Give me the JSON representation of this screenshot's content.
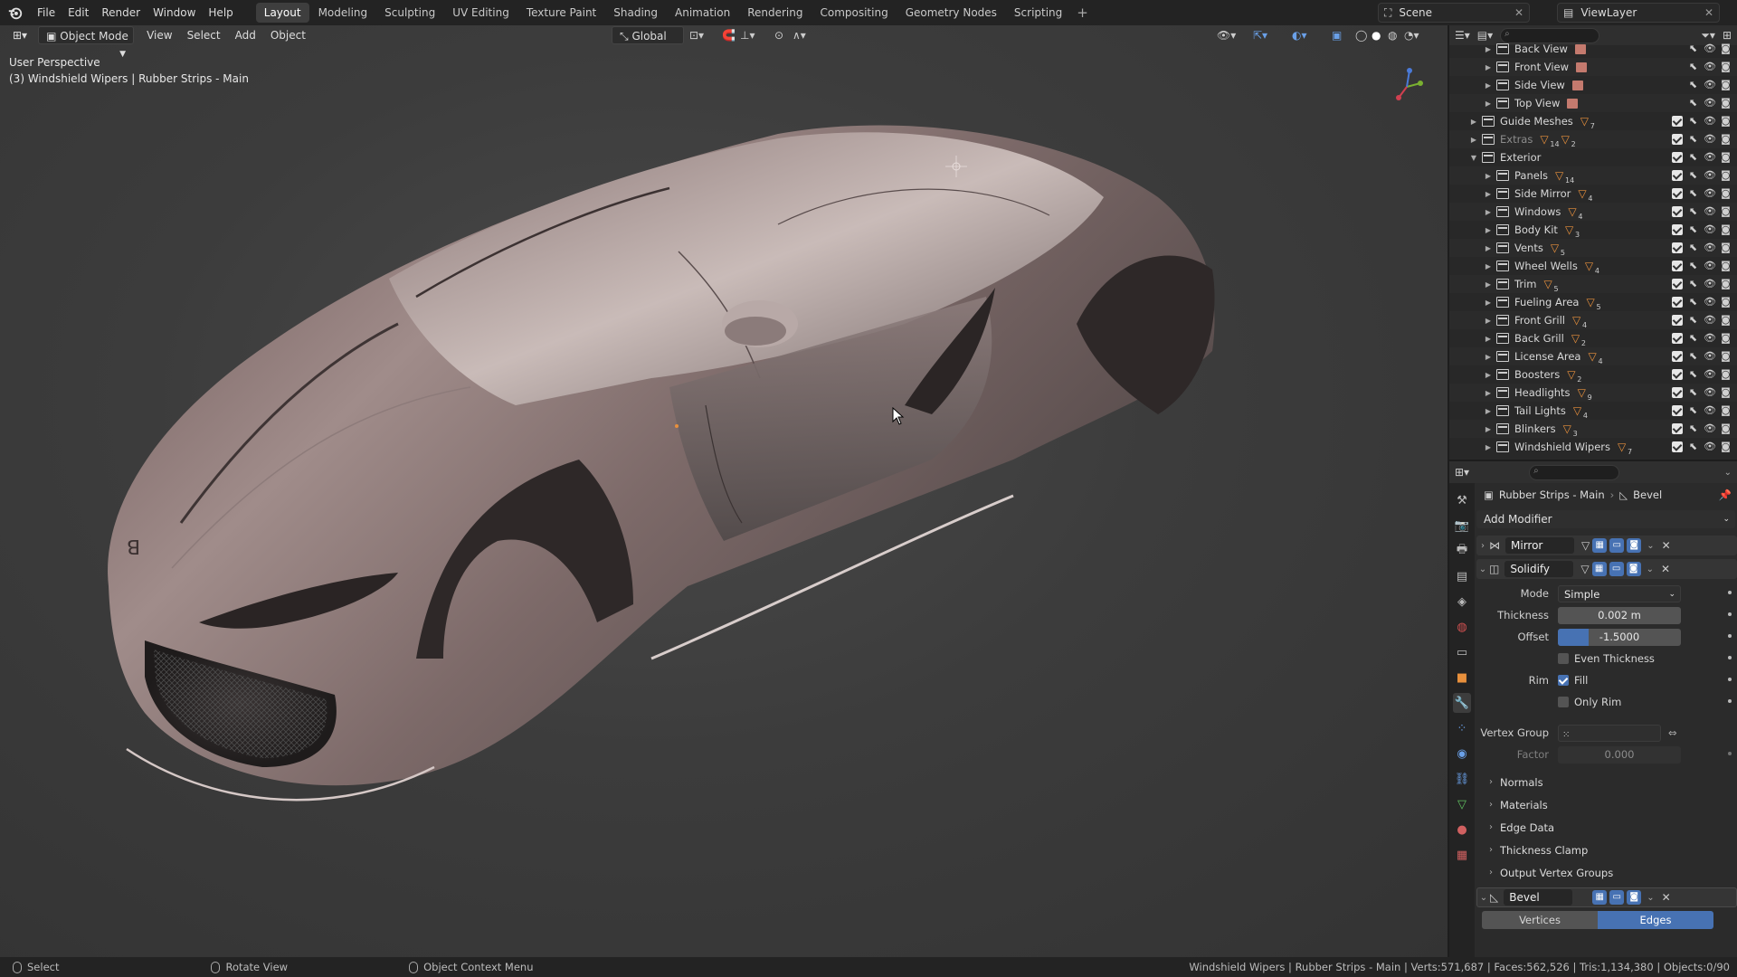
{
  "menu": {
    "items": [
      "File",
      "Edit",
      "Render",
      "Window",
      "Help"
    ],
    "workspaces": [
      "Layout",
      "Modeling",
      "Sculpting",
      "UV Editing",
      "Texture Paint",
      "Shading",
      "Animation",
      "Rendering",
      "Compositing",
      "Geometry Nodes",
      "Scripting"
    ],
    "active_workspace": "Layout",
    "add_tab": "+"
  },
  "scene": {
    "scene_name": "Scene",
    "view_layer": "ViewLayer"
  },
  "viewport": {
    "mode": "Object Mode",
    "menus": [
      "View",
      "Select",
      "Add",
      "Object"
    ],
    "orientation": "Global",
    "perspective_label": "User Perspective",
    "object_label": "(3) Windshield Wipers | Rubber Strips - Main"
  },
  "outliner": {
    "rows": [
      {
        "name": "Back View",
        "kind": "camera",
        "indent": 2
      },
      {
        "name": "Front View",
        "kind": "camera",
        "indent": 2
      },
      {
        "name": "Side View",
        "kind": "camera",
        "indent": 2
      },
      {
        "name": "Top View",
        "kind": "camera",
        "indent": 2
      },
      {
        "name": "Guide Meshes",
        "kind": "collection",
        "indent": 1,
        "count": "7"
      },
      {
        "name": "Extras",
        "kind": "collection",
        "indent": 1,
        "count": "14",
        "count2": "2",
        "dim": true
      },
      {
        "name": "Exterior",
        "kind": "collection",
        "indent": 1,
        "expanded": true
      },
      {
        "name": "Panels",
        "kind": "collection",
        "indent": 2,
        "count": "14"
      },
      {
        "name": "Side Mirror",
        "kind": "collection",
        "indent": 2,
        "count": "4"
      },
      {
        "name": "Windows",
        "kind": "collection",
        "indent": 2,
        "count": "4"
      },
      {
        "name": "Body Kit",
        "kind": "collection",
        "indent": 2,
        "count": "3"
      },
      {
        "name": "Vents",
        "kind": "collection",
        "indent": 2,
        "count": "5"
      },
      {
        "name": "Wheel Wells",
        "kind": "collection",
        "indent": 2,
        "count": "4"
      },
      {
        "name": "Trim",
        "kind": "collection",
        "indent": 2,
        "count": "5"
      },
      {
        "name": "Fueling Area",
        "kind": "collection",
        "indent": 2,
        "count": "5"
      },
      {
        "name": "Front Grill",
        "kind": "collection",
        "indent": 2,
        "count": "4"
      },
      {
        "name": "Back Grill",
        "kind": "collection",
        "indent": 2,
        "count": "2"
      },
      {
        "name": "License Area",
        "kind": "collection",
        "indent": 2,
        "count": "4"
      },
      {
        "name": "Boosters",
        "kind": "collection",
        "indent": 2,
        "count": "2"
      },
      {
        "name": "Headlights",
        "kind": "collection",
        "indent": 2,
        "count": "9"
      },
      {
        "name": "Tail Lights",
        "kind": "collection",
        "indent": 2,
        "count": "4"
      },
      {
        "name": "Blinkers",
        "kind": "collection",
        "indent": 2,
        "count": "3"
      },
      {
        "name": "Windshield Wipers",
        "kind": "collection",
        "indent": 2,
        "count": "7"
      }
    ]
  },
  "properties": {
    "object_name": "Rubber Strips - Main",
    "modifier_crumb": "Bevel",
    "add_modifier": "Add Modifier",
    "modifiers": {
      "mirror": "Mirror",
      "solidify": "Solidify",
      "bevel": "Bevel"
    },
    "solidify": {
      "mode_label": "Mode",
      "mode_value": "Simple",
      "thickness_label": "Thickness",
      "thickness_value": "0.002 m",
      "offset_label": "Offset",
      "offset_value": "-1.5000",
      "offset_fraction": 0.25,
      "even_thickness": "Even Thickness",
      "rim_label": "Rim",
      "fill": "Fill",
      "only_rim": "Only Rim",
      "vertex_group_label": "Vertex Group",
      "factor_label": "Factor",
      "factor_value": "0.000"
    },
    "subpanels": [
      "Normals",
      "Materials",
      "Edge Data",
      "Thickness Clamp",
      "Output Vertex Groups"
    ],
    "bevel_tabs": [
      "Vertices",
      "Edges"
    ],
    "bevel_active_tab": "Edges"
  },
  "statusbar": {
    "select": "Select",
    "rotate": "Rotate View",
    "context": "Object Context Menu",
    "stats": "Windshield Wipers | Rubber Strips - Main | Verts:571,687 | Faces:562,526 | Tris:1,134,380 | Objects:0/90"
  },
  "colors": {
    "accent": "#4772b3",
    "mesh_orange": "#e8903c",
    "active_tab_bg": "#3e3e3e"
  }
}
